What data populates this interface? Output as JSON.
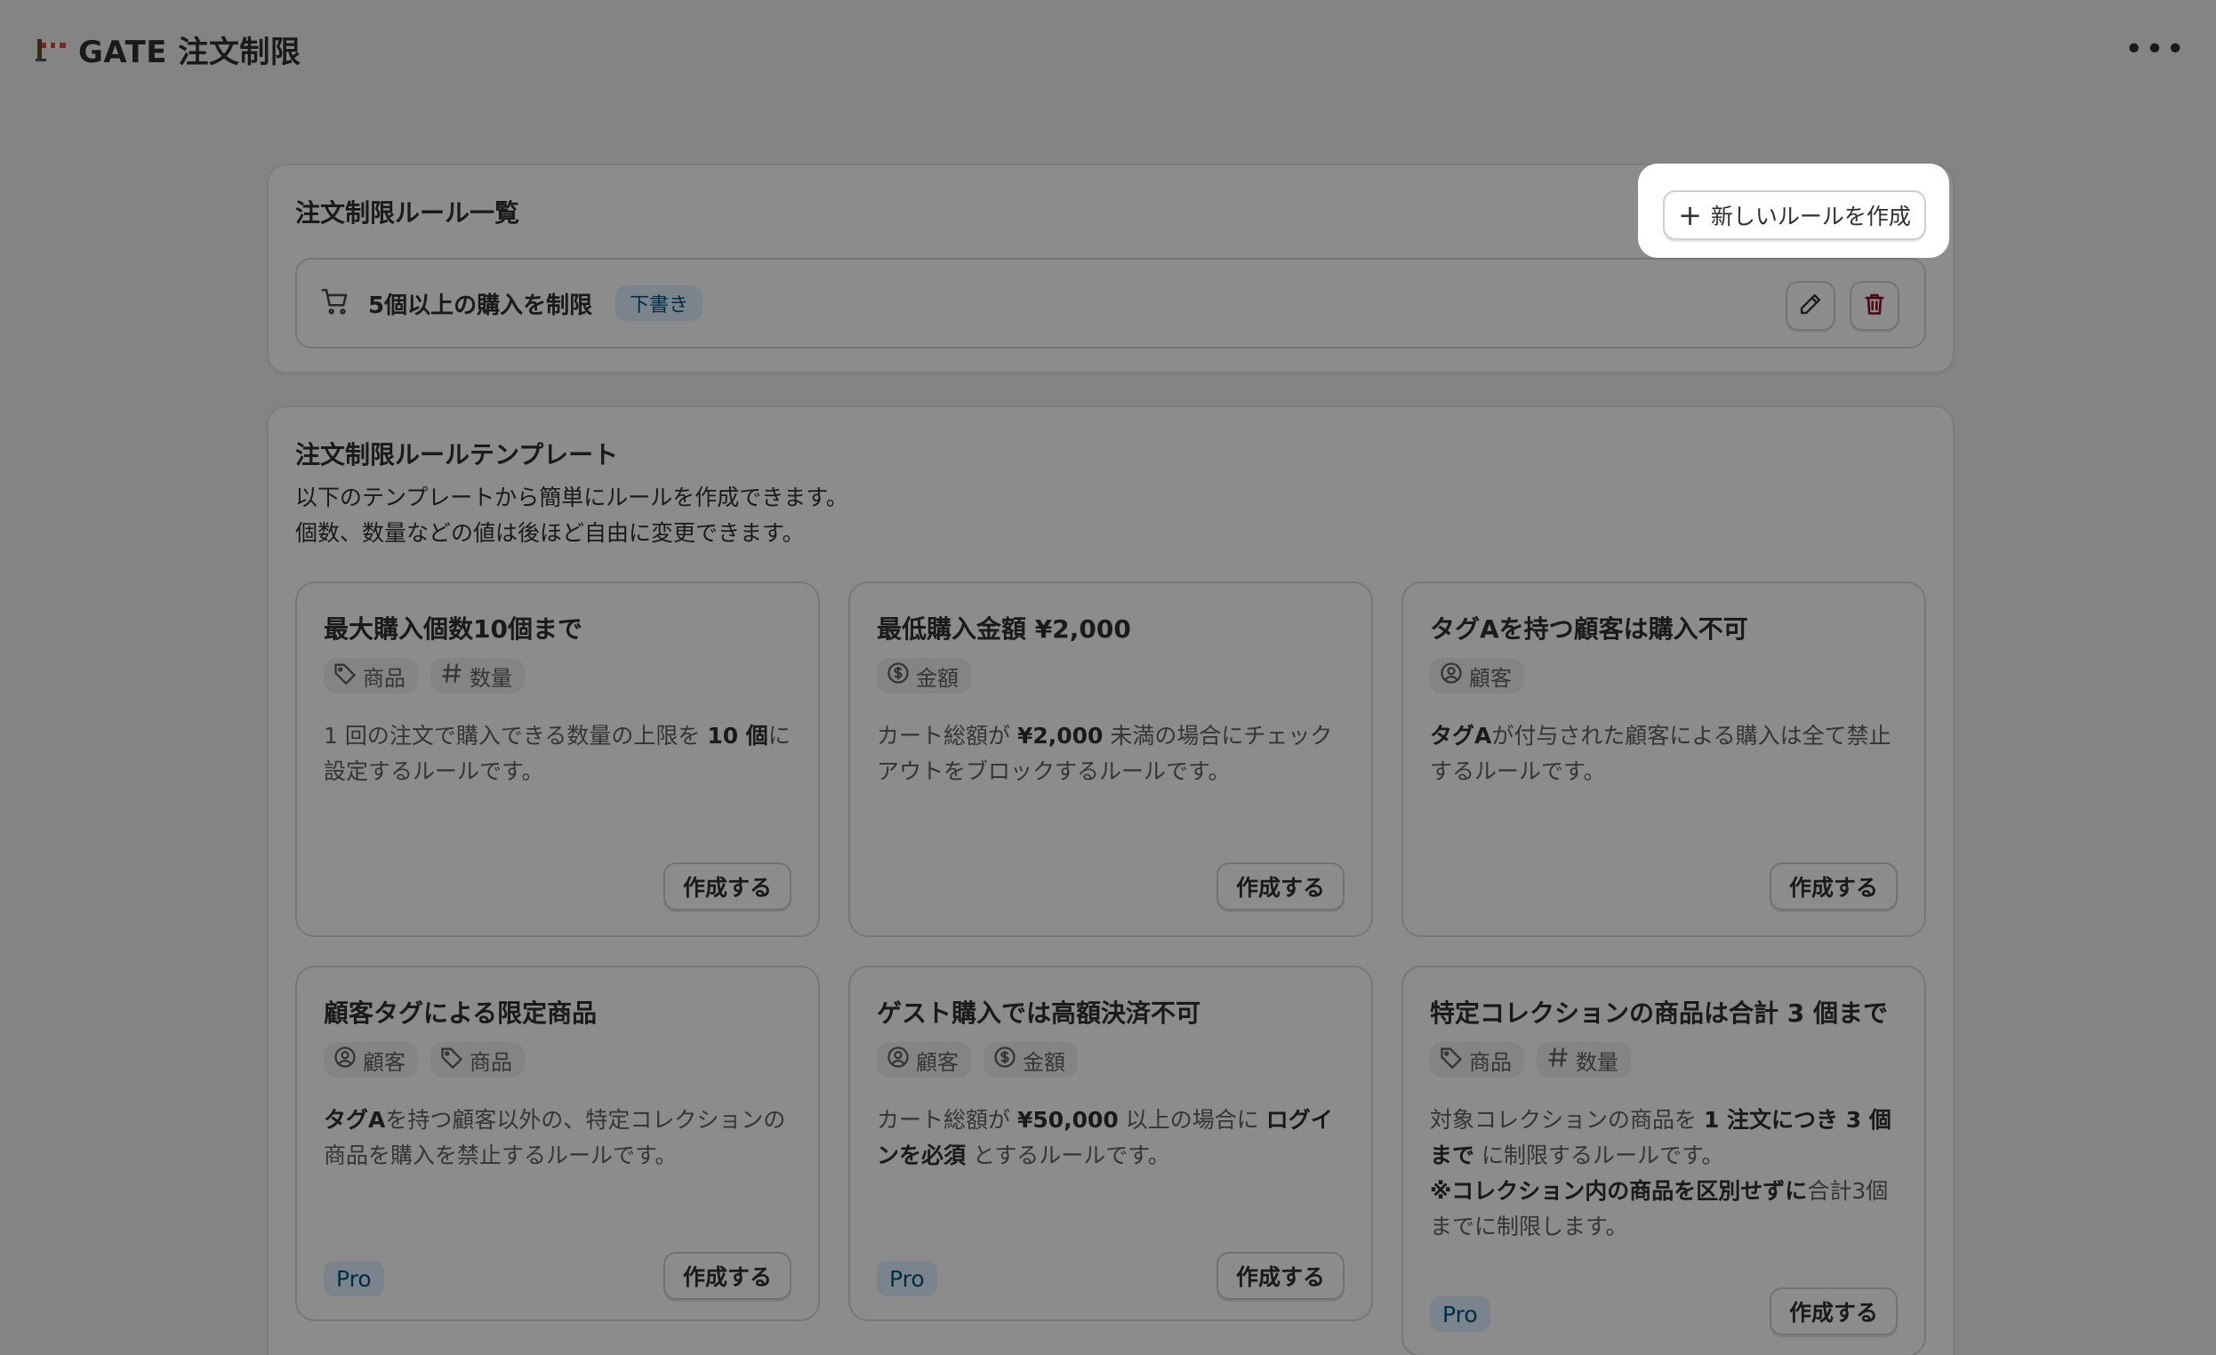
{
  "app": {
    "title": "GATE 注文制限",
    "more_label": "•••"
  },
  "rules_card": {
    "title": "注文制限ルール一覧",
    "new_rule_button": "新しいルールを作成",
    "rules": [
      {
        "name": "5個以上の購入を制限",
        "status": "下書き"
      }
    ]
  },
  "templates_card": {
    "title": "注文制限ルールテンプレート",
    "description_lines": [
      "以下のテンプレートから簡単にルールを作成できます。",
      "個数、数量などの値は後ほど自由に変更できます。"
    ],
    "create_label": "作成する",
    "pro_label": "Pro",
    "items": [
      {
        "title": "最大購入個数10個まで",
        "tags": [
          "商品",
          "数量"
        ]
      },
      {
        "title": "最低購入金額 ¥2,000",
        "tags": [
          "金額"
        ]
      },
      {
        "title": "タグAを持つ顧客は購入不可",
        "tags": [
          "顧客"
        ]
      },
      {
        "title": "顧客タグによる限定商品",
        "tags": [
          "顧客",
          "商品"
        ]
      },
      {
        "title": "ゲスト購入では高額決済不可",
        "tags": [
          "顧客",
          "金額"
        ]
      },
      {
        "title": "特定コレクションの商品は合計 3 個まで",
        "tags": [
          "商品",
          "数量"
        ]
      }
    ],
    "descriptions": {
      "t1": {
        "a": "1 回の注文で購入できる数量の上限を ",
        "b": "10 個",
        "c": "に設定するルールです。"
      },
      "t2": {
        "a": "カート総額が ",
        "b": "¥2,000",
        "c": " 未満の場合にチェックアウトをブロックするルールです。"
      },
      "t3": {
        "b": "タグA",
        "c": "が付与された顧客による購入は全て禁止するルールです。"
      },
      "t4": {
        "b": "タグA",
        "c": "を持つ顧客以外の、特定コレクションの商品を購入を禁止するルールです。"
      },
      "t5": {
        "a": "カート総額が ",
        "b": "¥50,000",
        "c": " 以上の場合に ",
        "d": "ログインを必須",
        "e": " とするルールです。"
      },
      "t6": {
        "a": "対象コレクションの商品を ",
        "b": "1 注文につき 3 個まで",
        "c": " に制限するルールです。",
        "d": "※コレクション内の商品を区別せずに",
        "e": "合計3個までに制限します。"
      }
    },
    "tag_icons": {
      "商品": "tag-icon",
      "数量": "hash-icon",
      "金額": "dollar-circle-icon",
      "顧客": "person-circle-icon"
    }
  },
  "colors": {
    "accent_badge_bg": "#e0f0ff",
    "accent_badge_text": "#00527c",
    "delete_red": "#8e0b21"
  }
}
